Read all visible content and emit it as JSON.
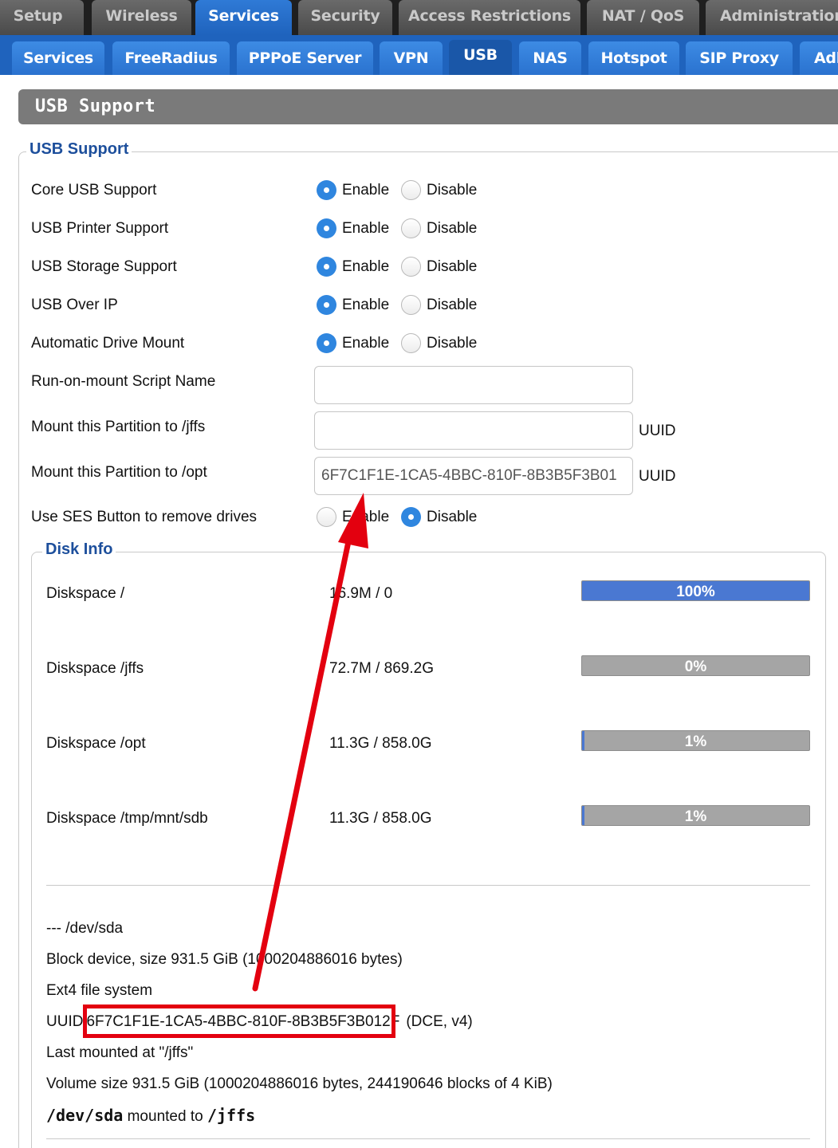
{
  "top_tabs": [
    "Setup",
    "Wireless",
    "Services",
    "Security",
    "Access Restrictions",
    "NAT / QoS",
    "Administration"
  ],
  "sub_tabs": [
    "Services",
    "FreeRadius",
    "PPPoE Server",
    "VPN",
    "USB",
    "NAS",
    "Hotspot",
    "SIP Proxy",
    "Adl"
  ],
  "page_title": "USB Support",
  "usb_section": {
    "legend": "USB Support",
    "enable_label": "Enable",
    "disable_label": "Disable",
    "rows": [
      {
        "label": "Core USB Support",
        "value": "Enable"
      },
      {
        "label": "USB Printer Support",
        "value": "Enable"
      },
      {
        "label": "USB Storage Support",
        "value": "Enable"
      },
      {
        "label": "USB Over IP",
        "value": "Enable"
      },
      {
        "label": "Automatic Drive Mount",
        "value": "Enable"
      }
    ],
    "run_on_mount": {
      "label": "Run-on-mount Script Name",
      "value": ""
    },
    "mount_jffs": {
      "label": "Mount this Partition to /jffs",
      "value": "",
      "suffix": "UUID"
    },
    "mount_opt": {
      "label": "Mount this Partition to /opt",
      "value": "6F7C1F1E-1CA5-4BBC-810F-8B3B5F3B01",
      "suffix": "UUID"
    },
    "ses_button": {
      "label": "Use SES Button to remove drives",
      "value": "Disable"
    }
  },
  "disk_info": {
    "legend": "Disk Info",
    "disks": [
      {
        "label": "Diskspace /",
        "usage": "16.9M / 0",
        "percent_label": "100%",
        "percent": 100
      },
      {
        "label": "Diskspace /jffs",
        "usage": "72.7M / 869.2G",
        "percent_label": "0%",
        "percent": 0
      },
      {
        "label": "Diskspace /opt",
        "usage": "11.3G / 858.0G",
        "percent_label": "1%",
        "percent": 1
      },
      {
        "label": "Diskspace /tmp/mnt/sdb",
        "usage": "11.3G / 858.0G",
        "percent_label": "1%",
        "percent": 1
      }
    ],
    "device_header": "--- /dev/sda",
    "block_device": "Block device, size 931.5 GiB (1000204886016 bytes)",
    "filesystem": "Ext4 file system",
    "uuid_prefix": "UUID",
    "uuid_value": "6F7C1F1E-1CA5-4BBC-810F-8B3B5F3B012F",
    "uuid_suffix": "(DCE, v4)",
    "last_mounted": "Last mounted at \"/jffs\"",
    "volume_size": "Volume size 931.5 GiB (1000204886016 bytes, 244190646 blocks of 4 KiB)",
    "mount_device": "/dev/sda",
    "mount_word": "mounted to",
    "mount_target": "/jffs"
  },
  "annotation_colors": {
    "arrow": "#e3000f",
    "highlight_box": "#e3000f"
  },
  "colors": {
    "active_tab": "#1f63bd",
    "radio_on": "#2f86df",
    "legend": "#1d4f9c",
    "bar_fill": "#4a78d2"
  }
}
